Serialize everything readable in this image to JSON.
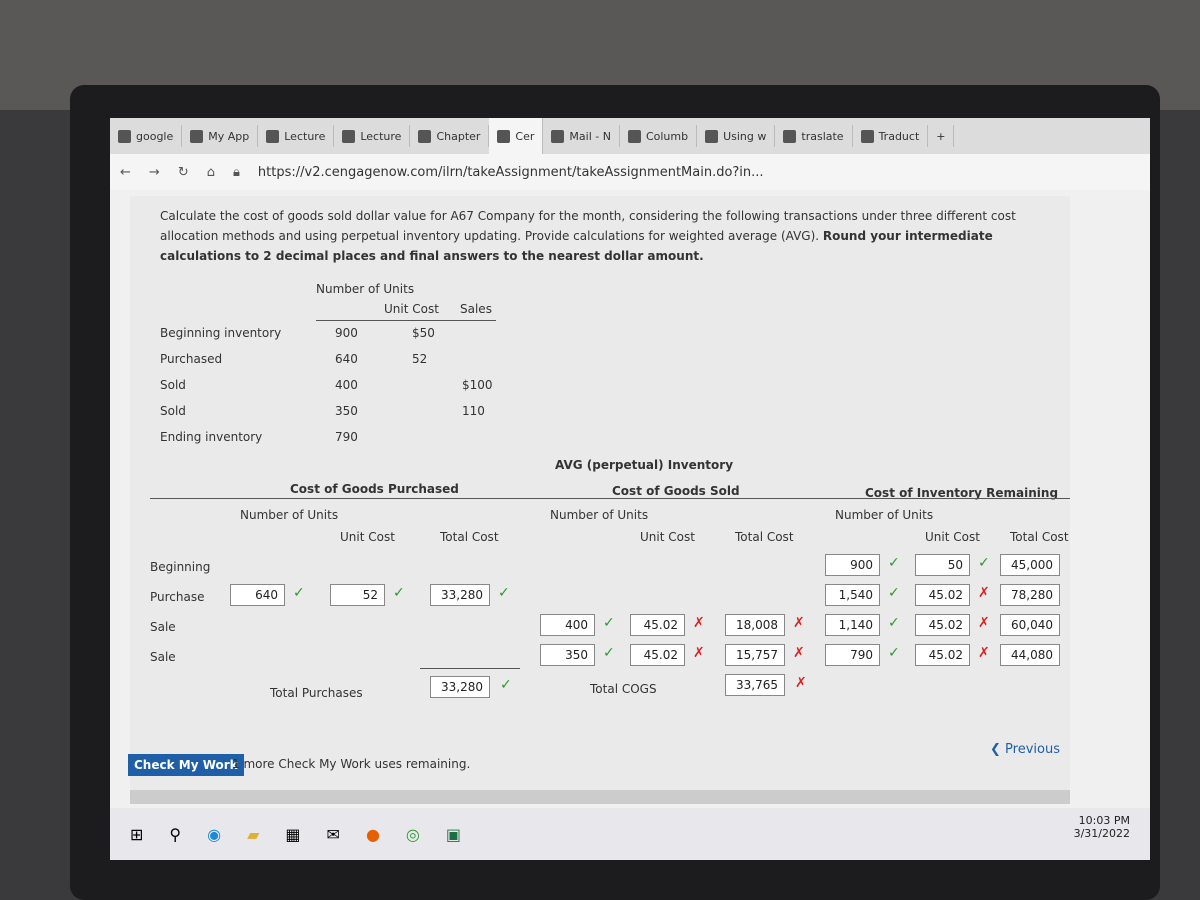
{
  "browser": {
    "tabs": [
      "google",
      "My App",
      "Lecture",
      "Lecture",
      "Chapter",
      "Cer",
      "Mail - N",
      "Columb",
      "Using w",
      "traslate",
      "Traduct"
    ],
    "new_tab": "+",
    "url": "https://v2.cengagenow.com/ilrn/takeAssignment/takeAssignmentMain.do?in..."
  },
  "question": {
    "text": "Calculate the cost of goods sold dollar value for A67 Company for the month, considering the following transactions under three different cost allocation methods and using perpetual inventory updating. Provide calculations for weighted average (AVG).",
    "bold": "Round your intermediate calculations to 2 decimal places and final answers to the nearest dollar amount."
  },
  "given": {
    "headers": [
      "Number of Units",
      "Unit Cost",
      "Sales"
    ],
    "rows": [
      {
        "label": "Beginning inventory",
        "units": "900",
        "cost": "$50",
        "sales": ""
      },
      {
        "label": "Purchased",
        "units": "640",
        "cost": "52",
        "sales": ""
      },
      {
        "label": "Sold",
        "units": "400",
        "cost": "",
        "sales": "$100"
      },
      {
        "label": "Sold",
        "units": "350",
        "cost": "",
        "sales": "110"
      },
      {
        "label": "Ending inventory",
        "units": "790",
        "cost": "",
        "sales": ""
      }
    ]
  },
  "avg": {
    "title": "AVG (perpetual) Inventory",
    "groups": [
      "Cost of Goods Purchased",
      "Cost of Goods Sold",
      "Cost of Inventory Remaining"
    ],
    "col_headers": [
      "Number of Units",
      "Unit Cost",
      "Total Cost"
    ],
    "rows": [
      {
        "label": "Beginning",
        "purchased": [
          "",
          "",
          ""
        ],
        "sold": [
          "",
          "",
          ""
        ],
        "remaining": [
          "900",
          "50",
          "45,000"
        ],
        "rem_status": [
          "ok",
          "ok",
          ""
        ]
      },
      {
        "label": "Purchase",
        "purchased": [
          "640",
          "52",
          "33,280"
        ],
        "pur_status": [
          "ok",
          "ok",
          "ok"
        ],
        "sold": [
          "",
          "",
          ""
        ],
        "remaining": [
          "1,540",
          "45.02",
          "78,280"
        ],
        "rem_status": [
          "ok",
          "bad",
          ""
        ]
      },
      {
        "label": "Sale",
        "purchased": [
          "",
          "",
          ""
        ],
        "sold": [
          "400",
          "45.02",
          "18,008"
        ],
        "sold_status": [
          "ok",
          "bad",
          "bad"
        ],
        "remaining": [
          "1,140",
          "45.02",
          "60,040"
        ],
        "rem_status": [
          "ok",
          "bad",
          ""
        ]
      },
      {
        "label": "Sale",
        "purchased": [
          "",
          "",
          ""
        ],
        "sold": [
          "350",
          "45.02",
          "15,757"
        ],
        "sold_status": [
          "ok",
          "bad",
          "bad"
        ],
        "remaining": [
          "790",
          "45.02",
          "44,080"
        ],
        "rem_status": [
          "ok",
          "bad",
          ""
        ]
      }
    ],
    "total_purchases_label": "Total Purchases",
    "total_purchases": "33,280",
    "total_cogs_label": "Total COGS",
    "total_cogs": "33,765"
  },
  "footer": {
    "check_label": "Check My Work",
    "remaining": "1 more Check My Work uses remaining.",
    "previous": "Previous"
  },
  "taskbar": {
    "time": "10:03 PM",
    "date": "3/31/2022"
  },
  "colors": {
    "check": "#2a9a2a",
    "cross": "#d22222",
    "button": "#1f5fa8"
  }
}
